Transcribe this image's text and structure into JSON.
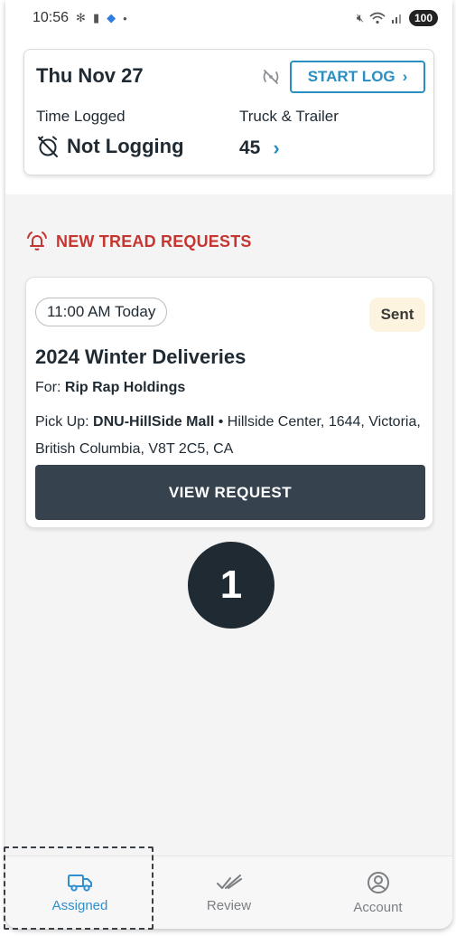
{
  "status_bar": {
    "time": "10:56",
    "battery": "100"
  },
  "log_card": {
    "date": "Thu Nov 27",
    "start_log_label": "START LOG",
    "time_logged_label": "Time Logged",
    "logging_status": "Not Logging",
    "truck_trailer_label": "Truck & Trailer",
    "truck_trailer_count": "45"
  },
  "section": {
    "title": "NEW TREAD REQUESTS"
  },
  "request": {
    "time_chip": "11:00 AM Today",
    "status": "Sent",
    "title": "2024 Winter Deliveries",
    "for_label": "For:",
    "for_value": "Rip Rap Holdings",
    "pickup_label": "Pick Up:",
    "pickup_location": "DNU-HillSide Mall",
    "pickup_address": "Hillside Center, 1644, Victoria, British Columbia, V8T 2C5, CA",
    "view_button": "VIEW REQUEST"
  },
  "step_marker": "1",
  "nav": {
    "items": [
      {
        "label": "Assigned",
        "icon": "truck-icon",
        "active": true
      },
      {
        "label": "Review",
        "icon": "double-check-icon",
        "active": false
      },
      {
        "label": "Account",
        "icon": "account-icon",
        "active": false
      }
    ]
  },
  "colors": {
    "accent": "#2a8ec1",
    "alert": "#c6352f",
    "button_dark": "#36434e",
    "nav_active": "#2f8fd0"
  }
}
